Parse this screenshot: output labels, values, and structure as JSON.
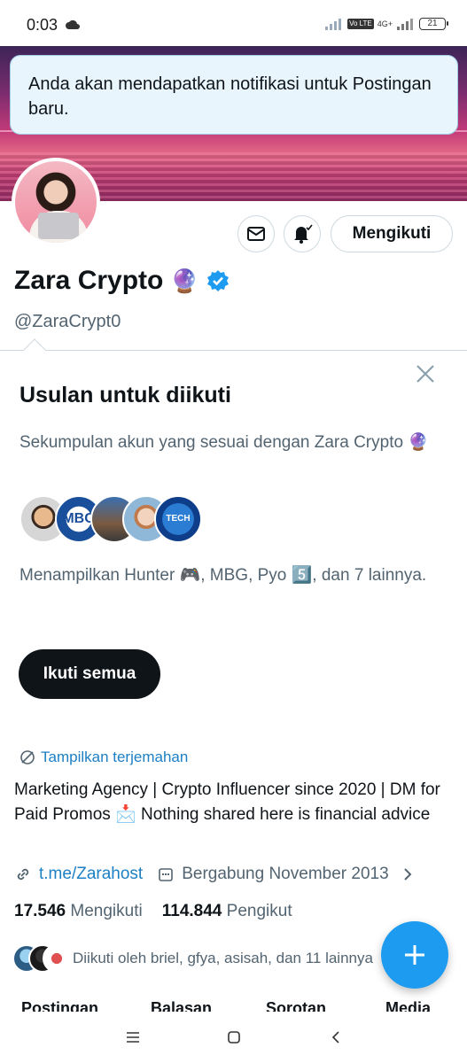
{
  "status_bar": {
    "time": "0:03",
    "volte": "Vo LTE",
    "network": "4G+",
    "battery": "21"
  },
  "toast": {
    "message": "Anda akan mendapatkan notifikasi untuk Postingan baru."
  },
  "profile": {
    "name": "Zara Crypto",
    "name_emoji": "🔮",
    "handle": "@ZaraCrypt0",
    "follow_state_label": "Mengikuti"
  },
  "suggestions": {
    "title": "Usulan untuk diikuti",
    "description": "Sekumpulan akun yang sesuai dengan Zara Crypto 🔮",
    "avatar_labels": [
      "MBG",
      "TECH"
    ],
    "showing_text": "Menampilkan Hunter 🎮, MBG, Pyo 5️⃣, dan 7 lainnya.",
    "follow_all_label": "Ikuti semua"
  },
  "bio": {
    "translate_label": "Tampilkan terjemahan",
    "text": "Marketing Agency | Crypto Influencer since 2020 | DM for Paid Promos 📩 Nothing shared here is financial advice",
    "link": "t.me/Zarahost",
    "joined": "Bergabung November 2013",
    "following_count": "17.546",
    "following_label": "Mengikuti",
    "followers_count": "114.844",
    "followers_label": "Pengikut",
    "followed_by": "Diikuti oleh briel, gfya, asisah, dan 11 lainnya"
  },
  "tabs": [
    "Postingan",
    "Balasan",
    "Sorotan",
    "Media"
  ],
  "colors": {
    "accent": "#1d9bf0",
    "link": "#1d7fc4",
    "text_primary": "#0f1419",
    "text_secondary": "#536471"
  },
  "icons": {
    "status": [
      "cloud-icon",
      "signal-icon",
      "battery-icon"
    ],
    "actions": [
      "mail-icon",
      "bell-check-icon",
      "verified-icon",
      "close-icon",
      "translate-icon",
      "link-icon",
      "calendar-icon",
      "chevron-right-icon",
      "plus-icon"
    ],
    "nav": [
      "menu-icon",
      "home-square-icon",
      "back-icon"
    ]
  }
}
